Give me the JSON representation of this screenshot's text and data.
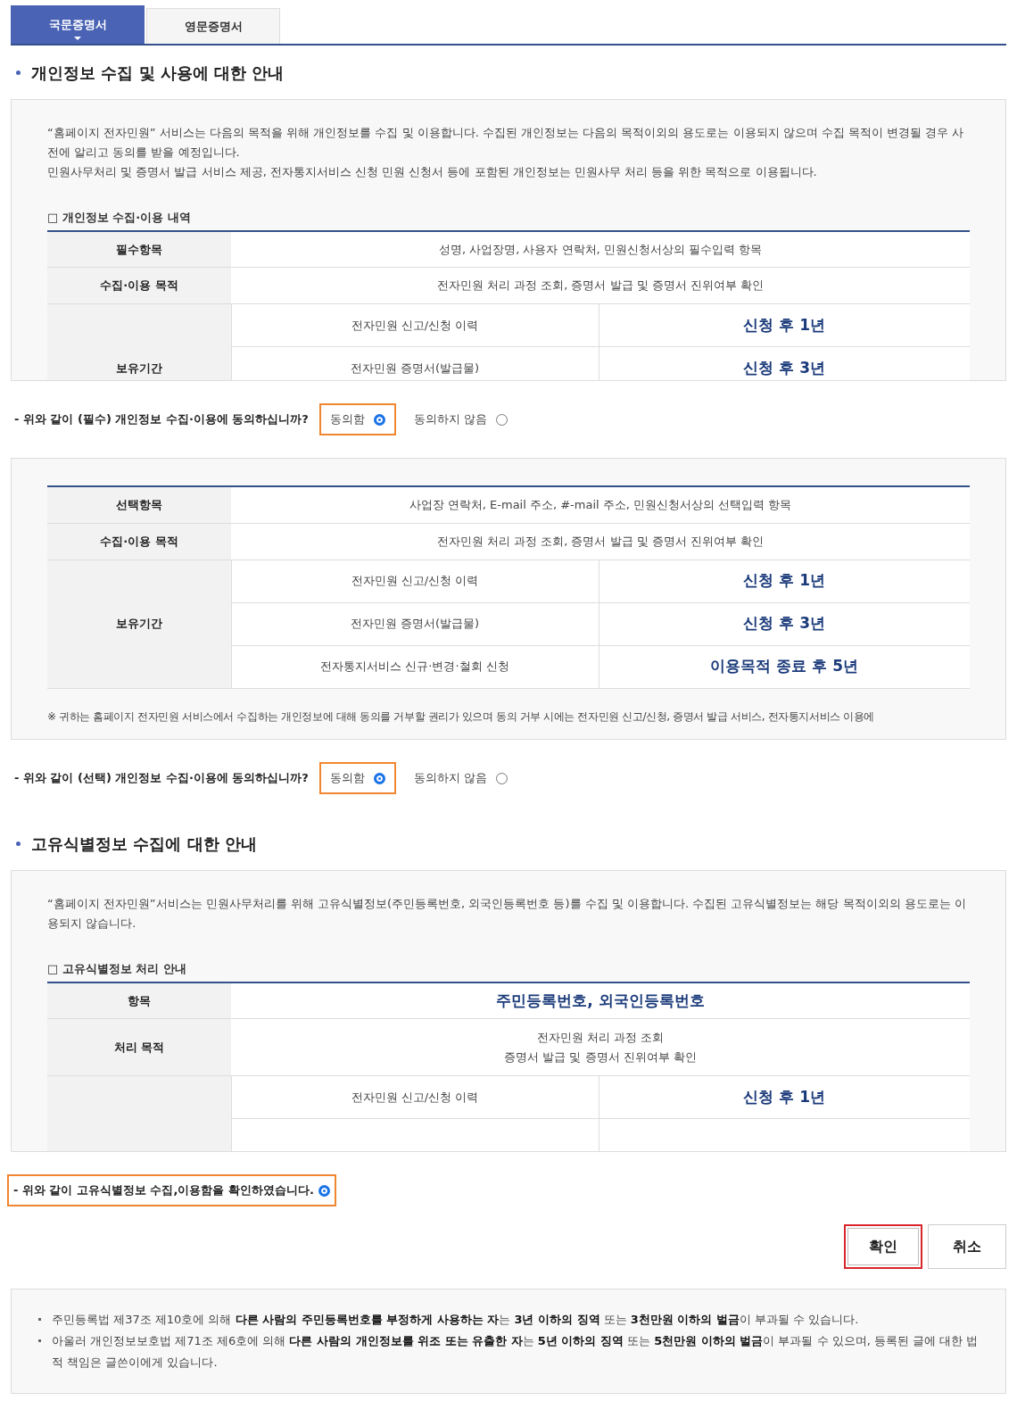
{
  "tabs": [
    {
      "label": "국문증명서",
      "selected": true
    },
    {
      "label": "영문증명서",
      "selected": false
    }
  ],
  "sections": [
    {
      "title": "개인정보 수집 및 사용에 대한 안내",
      "panels": [
        {
          "paragraphs": [
            "“홈페이지 전자민원” 서비스는 다음의 목적을 위해 개인정보를 수집 및 이용합니다. 수집된 개인정보는 다음의 목적이외의 용도로는 이용되지 않으며 수집 목적이 변경될 경우 사전에 알리고 동의를 받을 예정입니다.",
            "민원사무처리 및 증명서 발급 서비스 제공, 전자통지서비스 신청 민원 신청서 등에 포함된 개인정보는 민원사무 처리 등을 위한 목적으로 이용됩니다."
          ],
          "table_caption": "□ 개인정보 수집·이용 내역",
          "rows": [
            {
              "kind": "simple",
              "header": "필수항목",
              "value": "성명, 사업장명, 사용자 연락처, 민원신청서상의 필수입력 항목",
              "emphasis": false
            },
            {
              "kind": "simple",
              "header": "수집·이용 목적",
              "value": "전자민원 처리 과정 조회, 증명서 발급 및 증명서 진위여부 확인",
              "emphasis": false
            },
            {
              "kind": "retention",
              "header": "보유기간",
              "items": [
                {
                  "label": "전자민원 신고/신청 이력",
                  "period": "신청 후 1년"
                },
                {
                  "label": "전자민원 증명서(발급물)",
                  "period": "신청 후 3년"
                }
              ],
              "clipped": true
            }
          ],
          "consent": {
            "kind": "choice",
            "question": "- 위와 같이 (필수) 개인정보 수집·이용에 동의하십니까?",
            "options": [
              {
                "label": "동의함",
                "selected": true
              },
              {
                "label": "동의하지 않음",
                "selected": false
              }
            ]
          }
        },
        {
          "rows": [
            {
              "kind": "simple",
              "header": "선택항목",
              "value": "사업장 연락처, E-mail 주소, #-mail 주소, 민원신청서상의 선택입력 항목",
              "emphasis": false
            },
            {
              "kind": "simple",
              "header": "수집·이용 목적",
              "value": "전자민원 처리 과정 조회, 증명서 발급 및 증명서 진위여부 확인",
              "emphasis": false
            },
            {
              "kind": "retention",
              "header": "보유기간",
              "items": [
                {
                  "label": "전자민원 신고/신청 이력",
                  "period": "신청 후 1년"
                },
                {
                  "label": "전자민원 증명서(발급물)",
                  "period": "신청 후 3년"
                },
                {
                  "label": "전자통지서비스 신규·변경·철회 신청",
                  "period": "이용목적 종료 후 5년"
                }
              ],
              "clipped": false
            }
          ],
          "note": "※ 귀하는 홈페이지 전자민원 서비스에서 수집하는 개인정보에 대해 동의를 거부할 권리가 있으며 동의 거부 시에는 전자민원 신고/신청, 증명서 발급 서비스, 전자통지서비스 이용에",
          "consent": {
            "kind": "choice",
            "question": "- 위와 같이 (선택) 개인정보 수집·이용에 동의하십니까?",
            "options": [
              {
                "label": "동의함",
                "selected": true
              },
              {
                "label": "동의하지 않음",
                "selected": false
              }
            ]
          }
        }
      ]
    },
    {
      "title": "고유식별정보 수집에 대한 안내",
      "panels": [
        {
          "paragraphs": [
            "“홈페이지 전자민원”서비스는 민원사무처리를 위해 고유식별정보(주민등록번호, 외국인등록번호 등)를 수집 및 이용합니다. 수집된 고유식별정보는 해당 목적이외의 용도로는 이용되지 않습니다."
          ],
          "table_caption": "□ 고유식별정보 처리 안내",
          "rows": [
            {
              "kind": "simple",
              "header": "항목",
              "value": "주민등록번호, 외국인등록번호",
              "emphasis": true
            },
            {
              "kind": "multiline",
              "header": "처리 목적",
              "lines": [
                "전자민원 처리 과정 조회",
                "증명서 발급 및 증명서 진위여부 확인"
              ]
            },
            {
              "kind": "retention",
              "items": [
                {
                  "label": "전자민원 신고/신청 이력",
                  "period": "신청 후 1년"
                }
              ],
              "clipped": true
            }
          ],
          "consent": {
            "kind": "confirm",
            "statement": "- 위와 같이 고유식별정보 수집,이용함을 확인하였습니다.",
            "selected": true
          }
        }
      ]
    }
  ],
  "buttons": [
    {
      "label": "확인",
      "focused": true
    },
    {
      "label": "취소",
      "focused": false
    }
  ],
  "notices": [
    "주민등록법 제37조 제10호에 의해 **다른 사람의 주민등록번호를 부정하게 사용하는 자**는 **3년 이하의 징역** 또는 **3천만원 이하의 벌금**이 부과될 수 있습니다.",
    "아울러 개인정보보호법 제71조 제6호에 의해 **다른 사람의 개인정보를 위조 또는 유출한 자**는 **5년 이하의 징역** 또는 **5천만원 이하의 벌금**이 부과될 수 있으며, 등록된 글에 대한 법적 책임은 글쓴이에게 있습니다."
  ]
}
